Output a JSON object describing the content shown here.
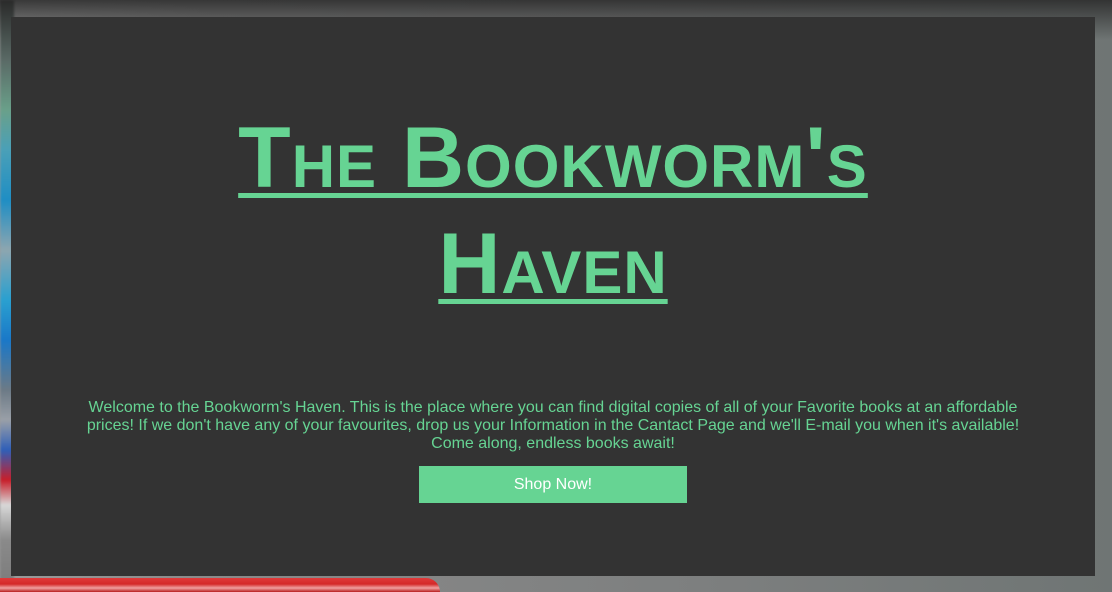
{
  "hero": {
    "title_line1": "The Bookworm's",
    "title_line2": "Haven",
    "intro_text": "Welcome to the Bookworm's Haven. This is the place where you can find digital copies of all of your Favorite books at an affordable prices! If we don't have any of your favourites, drop us your Information in the Cantact Page and we'll E-mail you when it's available! Come along, endless books await!",
    "cta_label": "Shop Now!"
  },
  "colors": {
    "accent": "#66d493",
    "panel_background": "#333333",
    "button_text": "#ffffff"
  }
}
